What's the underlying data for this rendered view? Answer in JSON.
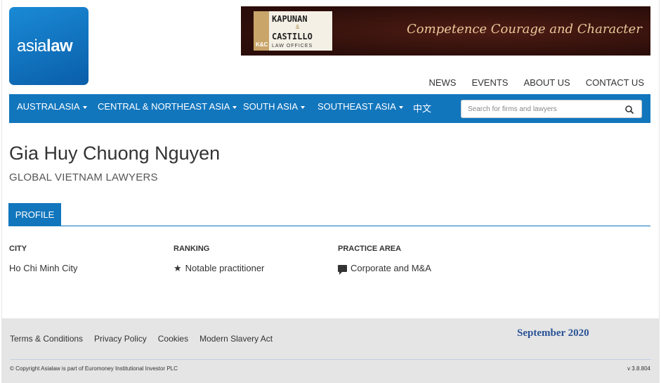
{
  "header": {
    "logo": {
      "text_light": "asia",
      "text_bold": "law"
    },
    "banner": {
      "firm_line1": "KAPUNAN",
      "amp": "&",
      "firm_line2": "CASTILLO",
      "kc": "K&C",
      "sub": "LAW OFFICES",
      "tagline": "Competence Courage and Character"
    },
    "top_nav": [
      "NEWS",
      "EVENTS",
      "ABOUT US",
      "CONTACT US"
    ],
    "main_nav": [
      "AUSTRALASIA",
      "CENTRAL & NORTHEAST ASIA",
      "SOUTH ASIA",
      "SOUTHEAST ASIA",
      "中文"
    ],
    "search": {
      "placeholder": "Search for firms and lawyers"
    }
  },
  "profile": {
    "name": "Gia Huy Chuong Nguyen",
    "firm": "GLOBAL VIETNAM LAWYERS",
    "tab": "PROFILE",
    "city_label": "CITY",
    "city_value": "Ho Chi Minh City",
    "ranking_label": "RANKING",
    "ranking_value": "Notable practitioner",
    "practice_label": "PRACTICE AREA",
    "practice_value": "Corporate and M&A"
  },
  "footer": {
    "links": [
      "Terms & Conditions",
      "Privacy Policy",
      "Cookies",
      "Modern Slavery Act"
    ],
    "date": "September 2020",
    "copyright": "© Copyright Asialaw is part of Euromoney Institutional Investor PLC",
    "version": "v 3.8.804"
  },
  "icons": {
    "search": "search-icon",
    "ranking": "star-icon",
    "practice": "comment-icon"
  },
  "colors": {
    "brand_blue": "#1276bd",
    "date_blue": "#2a5296",
    "banner_dark": "#3a130e"
  }
}
